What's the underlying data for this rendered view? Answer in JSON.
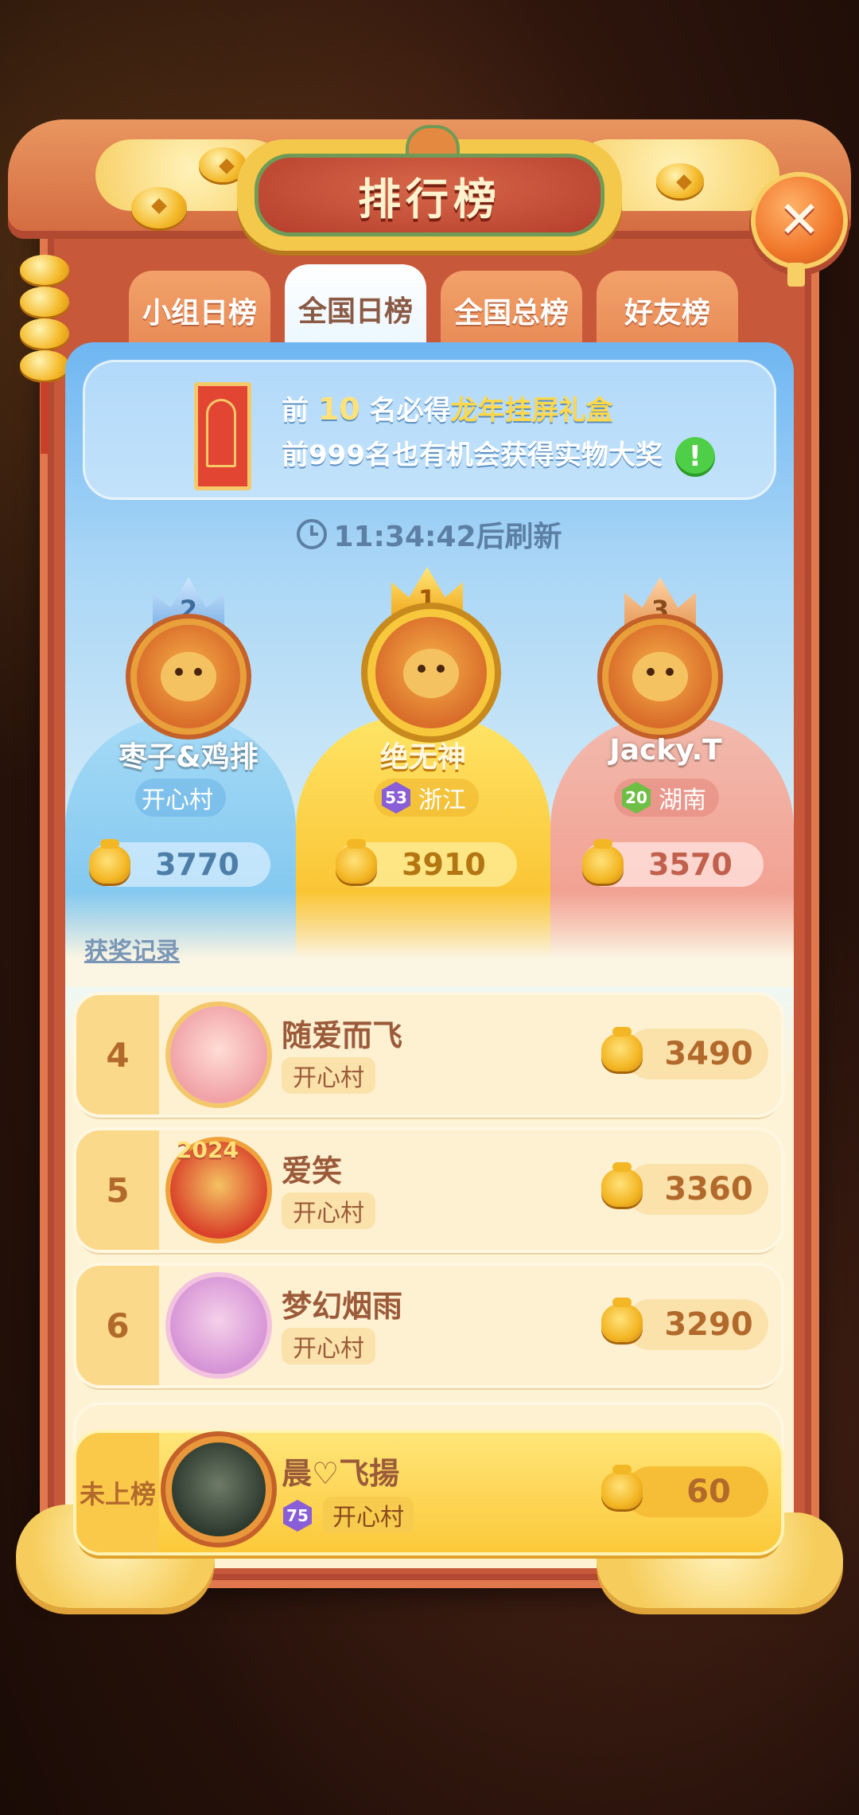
{
  "title": "排行榜",
  "close_symbol": "✕",
  "tabs": [
    {
      "label": "小组日榜",
      "active": false
    },
    {
      "label": "全国日榜",
      "active": true
    },
    {
      "label": "全国总榜",
      "active": false
    },
    {
      "label": "好友榜",
      "active": false
    }
  ],
  "announcement": {
    "line1_prefix": "前",
    "line1_number": "10",
    "line1_mid": "名必得",
    "line1_prize": "龙年挂屏礼盒",
    "line2": "前999名也有机会获得实物大奖",
    "info_symbol": "!"
  },
  "refresh": {
    "time": "11:34:42",
    "suffix": "后刷新"
  },
  "podium": [
    {
      "rank": "2",
      "name": "枣子&鸡排",
      "level": "",
      "location": "开心村",
      "score": "3770"
    },
    {
      "rank": "1",
      "name": "绝无神",
      "level": "53",
      "location": "浙江",
      "score": "3910"
    },
    {
      "rank": "3",
      "name": "Jacky.T",
      "level": "20",
      "location": "湖南",
      "score": "3570"
    }
  ],
  "award_record_link": "获奖记录",
  "list": [
    {
      "rank": "4",
      "name": "随爱而飞",
      "location": "开心村",
      "score": "3490"
    },
    {
      "rank": "5",
      "name": "爱笑",
      "location": "开心村",
      "score": "3360"
    },
    {
      "rank": "6",
      "name": "梦幻烟雨",
      "location": "开心村",
      "score": "3290"
    }
  ],
  "avatar_badge_year": "2024",
  "my_entry": {
    "rank_label": "未上榜",
    "name": "晨♡飞揚",
    "level": "75",
    "location": "开心村",
    "score": "60"
  },
  "colors": {
    "panel": "#c8583a",
    "gold": "#f7cf64",
    "accent_text": "#b26a2c"
  }
}
